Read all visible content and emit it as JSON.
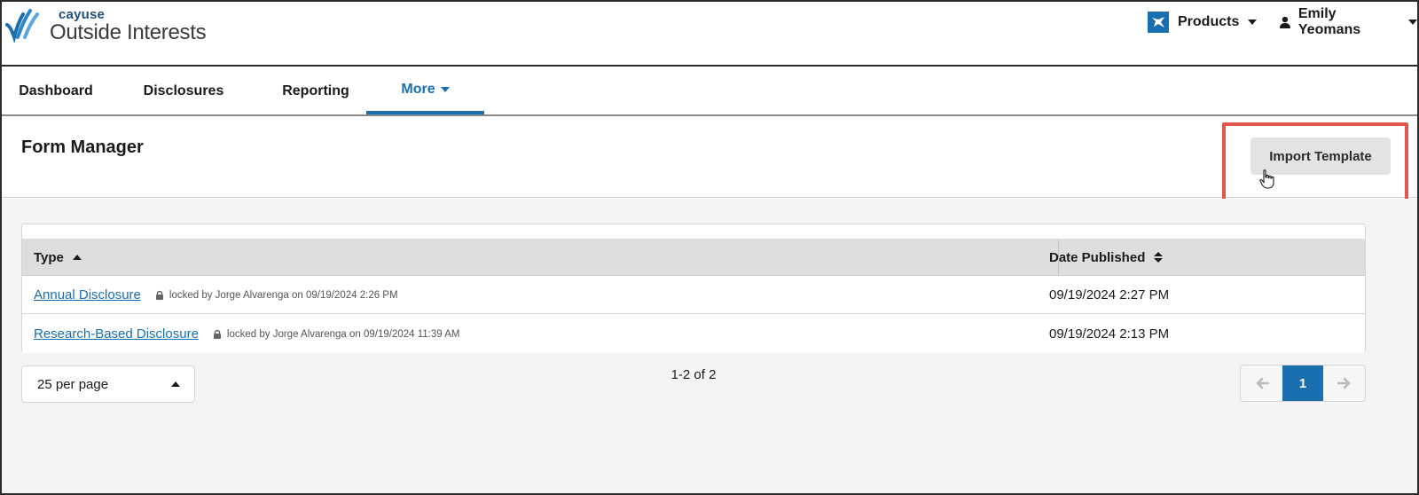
{
  "header": {
    "brand": "cayuse",
    "product": "Outside Interests",
    "products_label": "Products",
    "user_name": "Emily Yeomans"
  },
  "nav": {
    "items": [
      {
        "label": "Dashboard"
      },
      {
        "label": "Disclosures"
      },
      {
        "label": "Reporting"
      },
      {
        "label": "More"
      }
    ],
    "active_index": 3
  },
  "page": {
    "title": "Form Manager",
    "import_button_label": "Import Template"
  },
  "table": {
    "columns": [
      "Type",
      "Date Published"
    ],
    "rows": [
      {
        "type": "Annual Disclosure",
        "lock_note": "locked by Jorge Alvarenga on 09/19/2024 2:26 PM",
        "date_published": "09/19/2024 2:27 PM"
      },
      {
        "type": "Research-Based Disclosure",
        "lock_note": "locked by Jorge Alvarenga on 09/19/2024 11:39 AM",
        "date_published": "09/19/2024 2:13 PM"
      }
    ]
  },
  "pagination": {
    "per_page_label": "25 per page",
    "range_label": "1-2 of 2",
    "prev_symbol": "🡐",
    "next_symbol": "🡒",
    "current_page": "1"
  },
  "colors": {
    "accent": "#1a6fb0",
    "highlight": "#e2574c"
  },
  "icons": {
    "logo": "cayuse-wave-logo-icon",
    "products": "products-app-icon",
    "user": "user-icon",
    "lock": "lock-icon",
    "pointer": "hand-pointer-cursor-icon"
  }
}
